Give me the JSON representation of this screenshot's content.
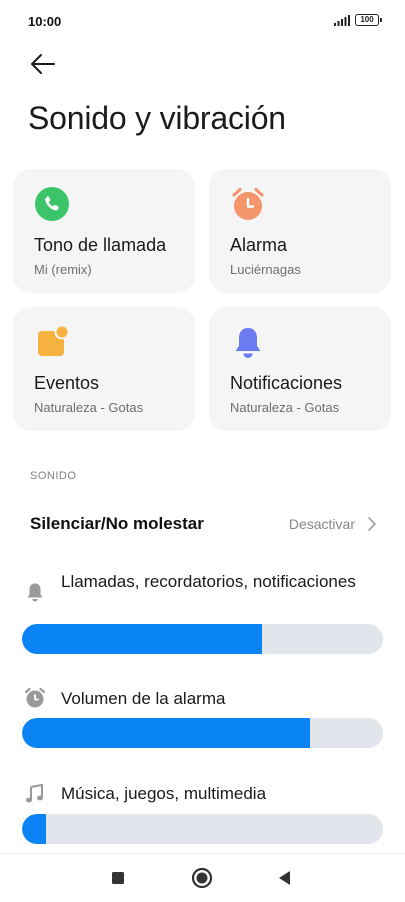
{
  "status_bar": {
    "time": "10:00",
    "battery": "100",
    "icons": [
      "signal-icon",
      "battery-icon"
    ]
  },
  "header": {
    "back_icon": "arrow-left-icon",
    "title": "Sonido y vibración"
  },
  "cards": [
    {
      "title": "Tono de llamada",
      "subtitle": "Mi (remix)",
      "icon": "phone-icon",
      "color": "#3cc46a"
    },
    {
      "title": "Alarma",
      "subtitle": "Luciérnagas",
      "icon": "alarm-clock-icon",
      "color": "#f5956c"
    },
    {
      "title": "Eventos",
      "subtitle": "Naturaleza - Gotas",
      "icon": "event-note-icon",
      "color": "#f5b23e"
    },
    {
      "title": "Notificaciones",
      "subtitle": "Naturaleza - Gotas",
      "icon": "bell-icon",
      "color": "#6b7bf2"
    }
  ],
  "sound_section": {
    "label": "SONIDO",
    "dnd": {
      "label": "Silenciar/No molestar",
      "value": "Desactivar",
      "icon": "chevron-right-icon"
    },
    "volumes": [
      {
        "label": "Llamadas, recordatorios, notificaciones",
        "icon": "bell-icon",
        "level": 0.665
      },
      {
        "label": "Volumen de la alarma",
        "icon": "alarm-clock-icon",
        "level": 0.797
      },
      {
        "label": "Música, juegos, multimedia",
        "icon": "music-note-icon",
        "level": 0.067
      }
    ]
  },
  "nav_bar": {
    "icons": [
      "recents-square-icon",
      "home-circle-icon",
      "back-triangle-icon"
    ]
  },
  "colors": {
    "accent": "#0a84f5",
    "track": "#e2e5ec",
    "card_bg": "#f5f5f5"
  }
}
